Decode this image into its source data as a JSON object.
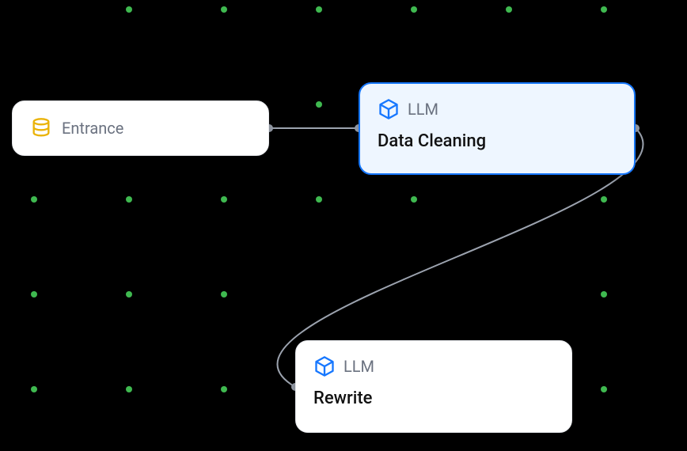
{
  "nodes": {
    "entrance": {
      "label": "Entrance"
    },
    "llm1": {
      "type": "LLM",
      "title": "Data Cleaning"
    },
    "llm2": {
      "type": "LLM",
      "title": "Rewrite"
    }
  }
}
